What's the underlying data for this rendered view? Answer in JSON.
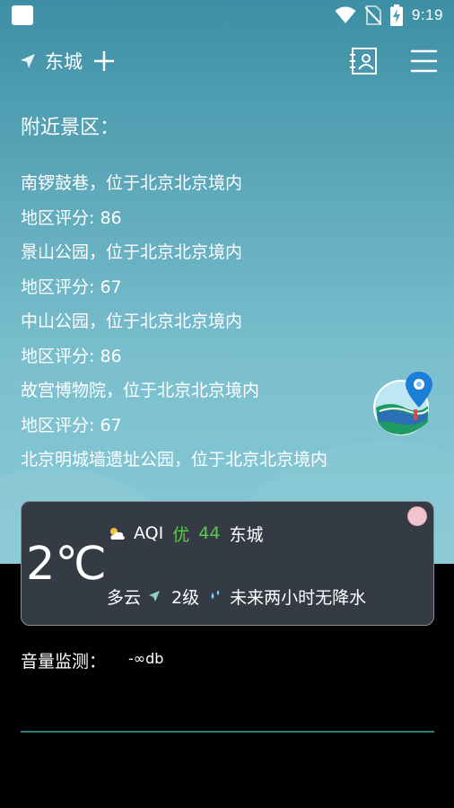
{
  "status_bar": {
    "time": "9:19",
    "icons": [
      "wifi-icon",
      "no-sim-icon",
      "battery-charging-icon"
    ]
  },
  "header": {
    "location_icon": "navigation-arrow-icon",
    "city": "东城",
    "add_icon": "plus-icon",
    "contact_icon": "contact-book-icon",
    "menu_icon": "hamburger-menu-icon"
  },
  "section_title": "附近景区：",
  "attractions": [
    {
      "name": "南锣鼓巷，位于北京北京境内",
      "score": "地区评分: 86"
    },
    {
      "name": "景山公园，位于北京北京境内",
      "score": "地区评分: 67"
    },
    {
      "name": "中山公园，位于北京北京境内",
      "score": "地区评分: 86"
    },
    {
      "name": "故宫博物院，位于北京北京境内",
      "score": "地区评分: 67"
    },
    {
      "name": "北京明城墙遗址公园，位于北京北京境内",
      "score": ""
    }
  ],
  "weather": {
    "temperature": "2℃",
    "aqi_label": "AQI",
    "aqi_level": "优",
    "aqi_value": "44",
    "city": "东城",
    "condition": "多云",
    "wind_level": "2级",
    "precipitation": "未来两小时无降水",
    "aqi_color": "#5cc94a"
  },
  "sound": {
    "label": "音量监测：",
    "value": "-∞db"
  },
  "colors": {
    "gradient_top": "#3d8fa5",
    "gradient_bottom": "#86c8d5",
    "card_bg": "#353b45",
    "divider": "#2d7f7a"
  }
}
